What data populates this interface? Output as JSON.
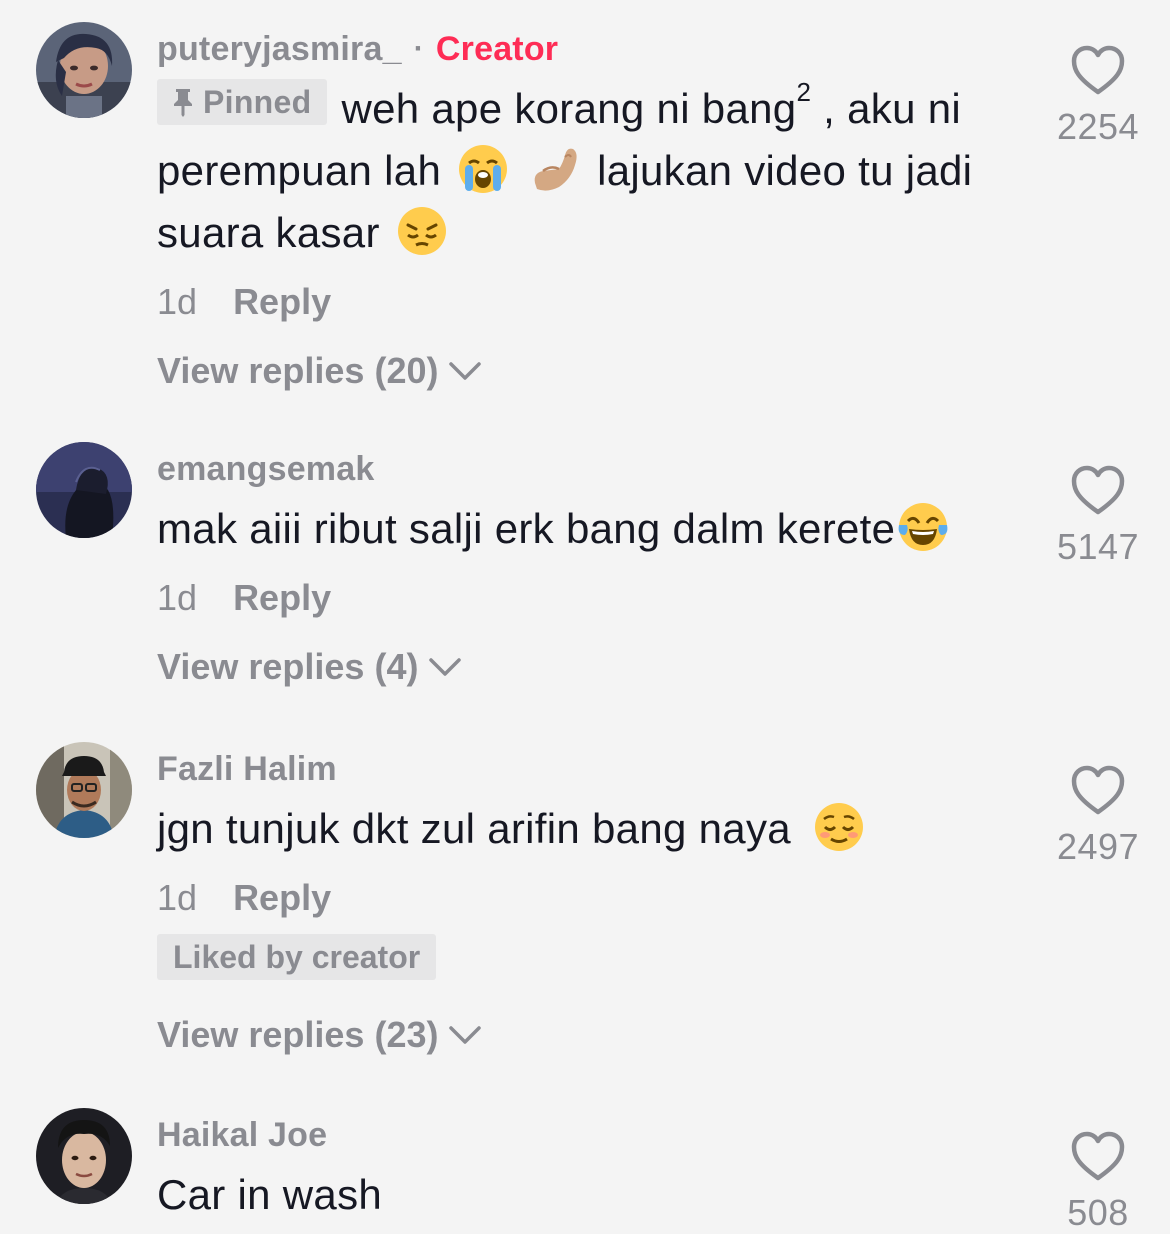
{
  "comments": [
    {
      "username": "puteryjasmira_",
      "creator_label": "Creator",
      "pinned_label": "Pinned",
      "text_a": "weh ape korang ni bang",
      "sup": "2",
      "text_b": " , aku ni perempuan lah",
      "text_c": " lajukan video tu jadi suara kasar",
      "time": "1d",
      "reply_label": "Reply",
      "view_replies": "View replies (20)",
      "likes": "2254"
    },
    {
      "username": "emangsemak",
      "text": "mak aiii ribut salji erk bang dalm kerete",
      "time": "1d",
      "reply_label": "Reply",
      "view_replies": "View replies (4)",
      "likes": "5147"
    },
    {
      "username": "Fazli Halim",
      "text": "jgn tunjuk dkt zul arifin bang naya",
      "time": "1d",
      "reply_label": "Reply",
      "liked_by_creator": "Liked by creator",
      "view_replies": "View replies (23)",
      "likes": "2497"
    },
    {
      "username": "Haikal Joe",
      "text": "Car in wash",
      "likes": "508"
    }
  ],
  "icons": {
    "like": "heart-outline-icon",
    "expand": "chevron-down-icon",
    "pin": "pin-icon"
  },
  "colors": {
    "background": "#f4f4f4",
    "creator": "#fe2c55",
    "muted": "#8a8b91",
    "text": "#161823"
  }
}
